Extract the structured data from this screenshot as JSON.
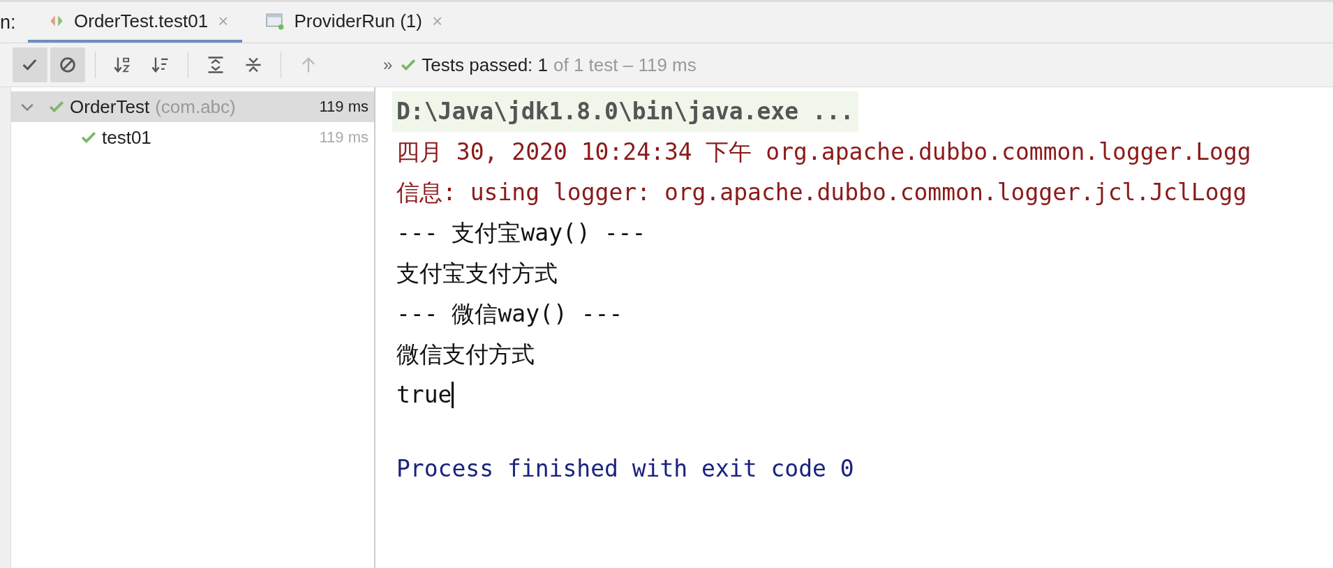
{
  "run_label": "n:",
  "tabs": [
    {
      "label": "OrderTest.test01",
      "selected": true,
      "kind": "test",
      "close": "×"
    },
    {
      "label": "ProviderRun (1)",
      "selected": false,
      "kind": "app",
      "close": "×"
    }
  ],
  "toolbar": {
    "buttons": [
      {
        "kind": "show-passed",
        "on": true,
        "disabled": false
      },
      {
        "kind": "show-ignored",
        "on": true,
        "disabled": false
      },
      {
        "kind": "sort-alpha",
        "on": false,
        "disabled": false
      },
      {
        "kind": "sort-duration",
        "on": false,
        "disabled": false
      },
      {
        "kind": "expand-all",
        "on": false,
        "disabled": false
      },
      {
        "kind": "collapse-all",
        "on": false,
        "disabled": false
      },
      {
        "kind": "previous",
        "on": false,
        "disabled": true
      }
    ],
    "more": "»",
    "status": {
      "prefix": "Tests passed: ",
      "count": "1",
      "detail": "of 1 test – 119 ms"
    }
  },
  "tree": [
    {
      "name": "OrderTest",
      "package": "(com.abc)",
      "time": "119 ms",
      "selected": true,
      "expanded": true,
      "children": [
        {
          "name": "test01",
          "time": "119 ms",
          "selected": false
        }
      ]
    }
  ],
  "console": {
    "lines": [
      {
        "kind": "command",
        "text": "D:\\Java\\jdk1.8.0\\bin\\java.exe ..."
      },
      {
        "kind": "stderr",
        "text": "四月 30, 2020 10:24:34 下午 org.apache.dubbo.common.logger.Logg"
      },
      {
        "kind": "stderr",
        "text": "信息: using logger: org.apache.dubbo.common.logger.jcl.JclLogg"
      },
      {
        "kind": "stdout",
        "text": "--- 支付宝way() ---"
      },
      {
        "kind": "stdout",
        "text": "支付宝支付方式"
      },
      {
        "kind": "stdout",
        "text": "--- 微信way() ---"
      },
      {
        "kind": "stdout",
        "text": "微信支付方式"
      },
      {
        "kind": "stdout",
        "text": "true",
        "cursor": true
      },
      {
        "kind": "system",
        "text": "Process finished with exit code 0"
      }
    ]
  }
}
